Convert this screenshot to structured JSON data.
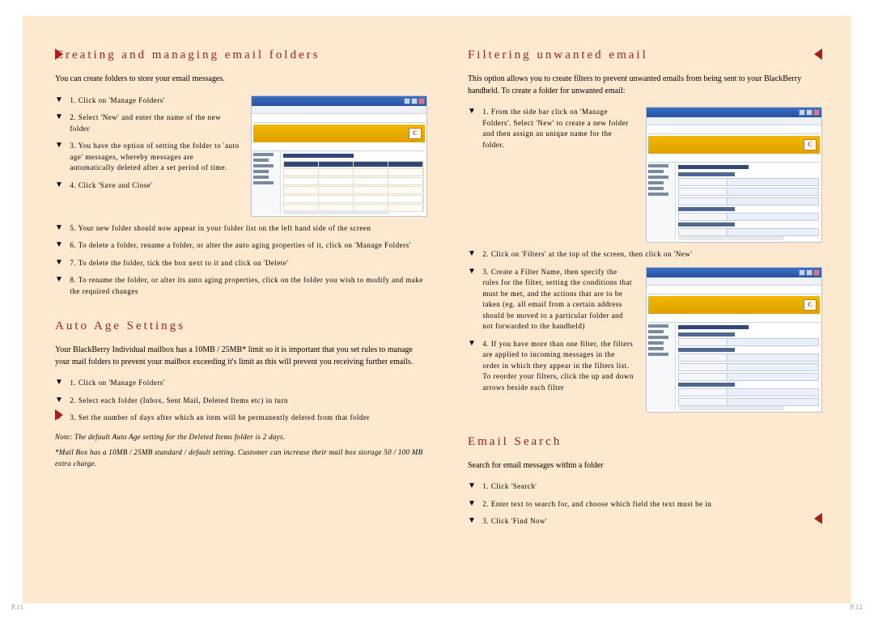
{
  "left": {
    "sec1": {
      "title": "Creating and managing email folders",
      "intro": "You can create folders to store your email messages.",
      "steps_a": [
        "1. Click on 'Manage Folders'",
        "2. Select 'New' and enter the name of the new folder",
        "3. You have the option of setting the folder to 'auto age' messages, whereby messages are automatically deleted after a set period of time.",
        "4. Click 'Save and Close'"
      ],
      "steps_b": [
        "5. Your new folder should now appear in your folder list on the left hand side of the screen",
        "6. To delete a folder, rename a folder, or alter the auto aging properties of it, click on 'Manage Folders'",
        "7. To delete the folder, tick the box next to it and click on 'Delete'",
        "8. To rename the folder, or alter its auto aging properties, click on the folder you wish to modify and make the required changes"
      ]
    },
    "sec2": {
      "title": "Auto Age Settings",
      "intro": "Your BlackBerry Individual mailbox has a 10MB / 25MB* limit so it is important that you set rules to manage your mail folders to prevent your mailbox exceeding it's limit as this will prevent you receiving further emails.",
      "steps": [
        "1. Click on 'Manage Folders'",
        "2. Select each folder (Inbox, Sent Mail, Deleted Items etc) in turn",
        "3. Set the number of days after which an item will be permanently deleted from that folder"
      ],
      "note1": "Note: The default Auto Age setting for the Deleted Items folder is 2 days.",
      "note2": "*Mail Box has a 10MB / 25MB standard / default setting. Customer can increase their mail box storage 50 / 100 MB extra charge."
    }
  },
  "right": {
    "sec1": {
      "title": "Filtering unwanted email",
      "intro": "This option allows you to create filters to prevent unwanted emails from being sent to your BlackBerry handheld. To create a folder for unwanted email:",
      "steps_a": [
        "1. From the side bar click on 'Manage Folders'. Select 'New' to create a new folder and then assign an unique name for the folder."
      ],
      "steps_b": [
        "2. Click on 'Filters' at the top of the screen, then click on 'New'"
      ],
      "steps_c": [
        "3. Create a Filter Name, then specify the rules for the filter, setting the conditions that must be met, and the actions that are to be taken (eg. all email from a certain address should be moved to a particular folder and not forwarded to the handheld)",
        "4. If you have more than one filter, the filters are applied to incoming messages in the order in which they appear in the filters list. To reorder your filters, click the up and down arrows beside each filter"
      ]
    },
    "sec2": {
      "title": "Email Search",
      "intro": "Search for email messages within a folder",
      "steps": [
        "1. Click 'Search'",
        "2. Enter text to search for, and choose which field the text must be in",
        "3. Click 'Find Now'"
      ]
    }
  },
  "pagenum_left": "P.11",
  "pagenum_right": "P.12"
}
